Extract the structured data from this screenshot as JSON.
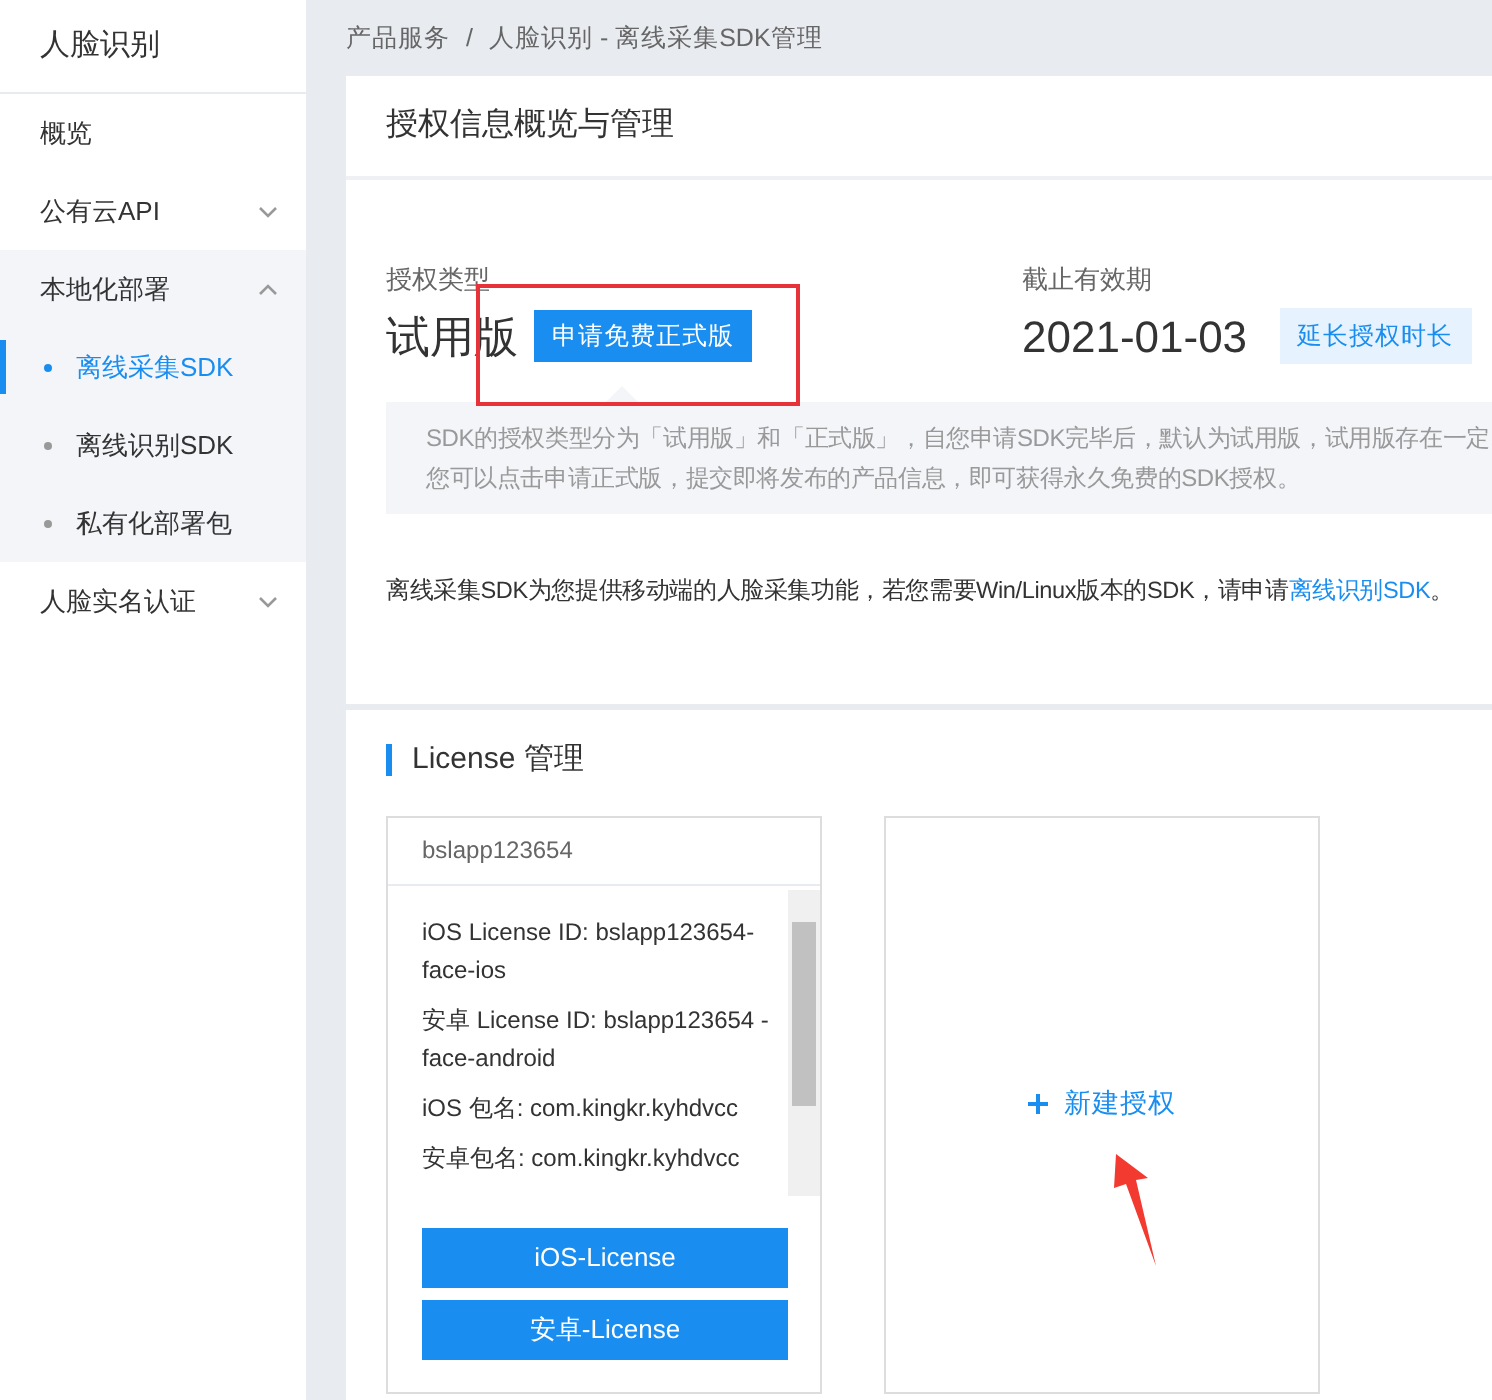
{
  "sidebar": {
    "title": "人脸识别",
    "items": [
      {
        "kind": "link",
        "label": "概览",
        "selected": false
      },
      {
        "kind": "group",
        "label": "公有云API",
        "expanded": false
      },
      {
        "kind": "group",
        "label": "本地化部署",
        "expanded": true,
        "children": [
          {
            "label": "离线采集SDK",
            "selected": true
          },
          {
            "label": "离线识别SDK",
            "selected": false
          },
          {
            "label": "私有化部署包",
            "selected": false
          }
        ]
      },
      {
        "kind": "group",
        "label": "人脸实名认证",
        "expanded": false
      }
    ]
  },
  "breadcrumb": {
    "items": [
      "产品服务",
      "人脸识别 - 离线采集SDK管理"
    ],
    "separator": "/"
  },
  "overview": {
    "title": "授权信息概览与管理",
    "license_type": {
      "label": "授权类型",
      "value": "试用版",
      "button": "申请免费正式版"
    },
    "expiry": {
      "label": "截止有效期",
      "value": "2021-01-03",
      "button": "延长授权时长"
    },
    "notice_lines": [
      "SDK的授权类型分为「试用版」和「正式版」，自您申请SDK完毕后，默认为试用版，试用版存在一定",
      "您可以点击申请正式版，提交即将发布的产品信息，即可获得永久免费的SDK授权。"
    ],
    "description": {
      "text": "离线采集SDK为您提供移动端的人脸采集功能，若您需要Win/Linux版本的SDK，请申请",
      "link": "离线识别SDK",
      "end": "。"
    }
  },
  "license_section": {
    "title": "License 管理",
    "cards": [
      {
        "kind": "license",
        "name": "bslapp123654",
        "details": [
          "iOS License ID: bslapp123654-face-ios",
          "安卓 License ID: bslapp123654 -face-android",
          "iOS 包名: com.kingkr.kyhdvcc",
          "安卓包名: com.kingkr.kyhdvcc"
        ],
        "buttons": [
          "iOS-License",
          "安卓-License"
        ]
      },
      {
        "kind": "new",
        "label": "新建授权"
      }
    ]
  },
  "annotations": {
    "highlight_frame": true,
    "arrow": true
  }
}
